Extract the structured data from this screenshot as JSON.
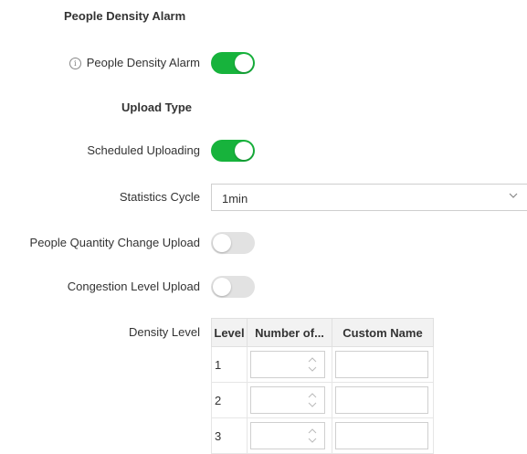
{
  "section_title": "People Density Alarm",
  "density_alarm": {
    "label": "People Density Alarm",
    "enabled": true,
    "icon": "info-icon"
  },
  "upload_type_title": "Upload Type",
  "scheduled_uploading": {
    "label": "Scheduled Uploading",
    "enabled": true
  },
  "statistics_cycle": {
    "label": "Statistics Cycle",
    "value": "1min",
    "icon": "chevron-down-icon"
  },
  "quantity_change_upload": {
    "label": "People Quantity Change Upload",
    "enabled": false
  },
  "congestion_upload": {
    "label": "Congestion Level Upload",
    "enabled": false
  },
  "density_level": {
    "label": "Density Level",
    "columns": [
      "Level",
      "Number of...",
      "Custom Name"
    ],
    "rows": [
      {
        "level": "1",
        "number": "",
        "name": ""
      },
      {
        "level": "2",
        "number": "",
        "name": ""
      },
      {
        "level": "3",
        "number": "",
        "name": ""
      }
    ]
  },
  "colors": {
    "toggle_on": "#17b33c",
    "toggle_off": "#e2e2e2"
  }
}
